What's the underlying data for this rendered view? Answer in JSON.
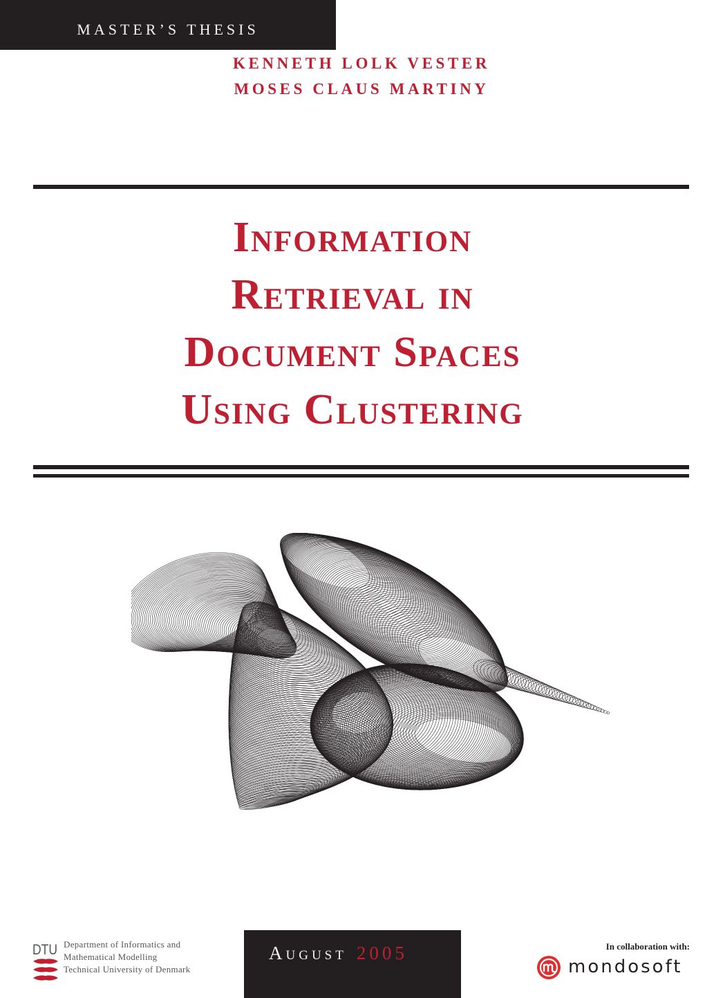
{
  "header": {
    "document_type": "MASTER’S THESIS",
    "authors": [
      "KENNETH LOLK VESTER",
      "MOSES CLAUS MARTINY"
    ]
  },
  "title": {
    "lines": [
      "Information",
      "Retrieval in",
      "Document Spaces",
      "Using Clustering"
    ]
  },
  "artwork": {
    "description": "abstract figure of overlapping ellipses forming a twisted surface with a trailing tail"
  },
  "footer": {
    "institution": {
      "logo_text": "DTU",
      "logo_icon": "dtu-waves-icon",
      "lines": [
        "Department of Informatics and",
        "Mathematical Modelling",
        "Technical University of Denmark"
      ]
    },
    "date": {
      "month": "August",
      "year": "2005"
    },
    "collaboration": {
      "label": "In collaboration with:",
      "partner": "mondosoft",
      "partner_icon": "mondosoft-m-icon"
    }
  },
  "colors": {
    "accent_red": "#be2032",
    "dark": "#231f20",
    "background": "#ffffff"
  }
}
